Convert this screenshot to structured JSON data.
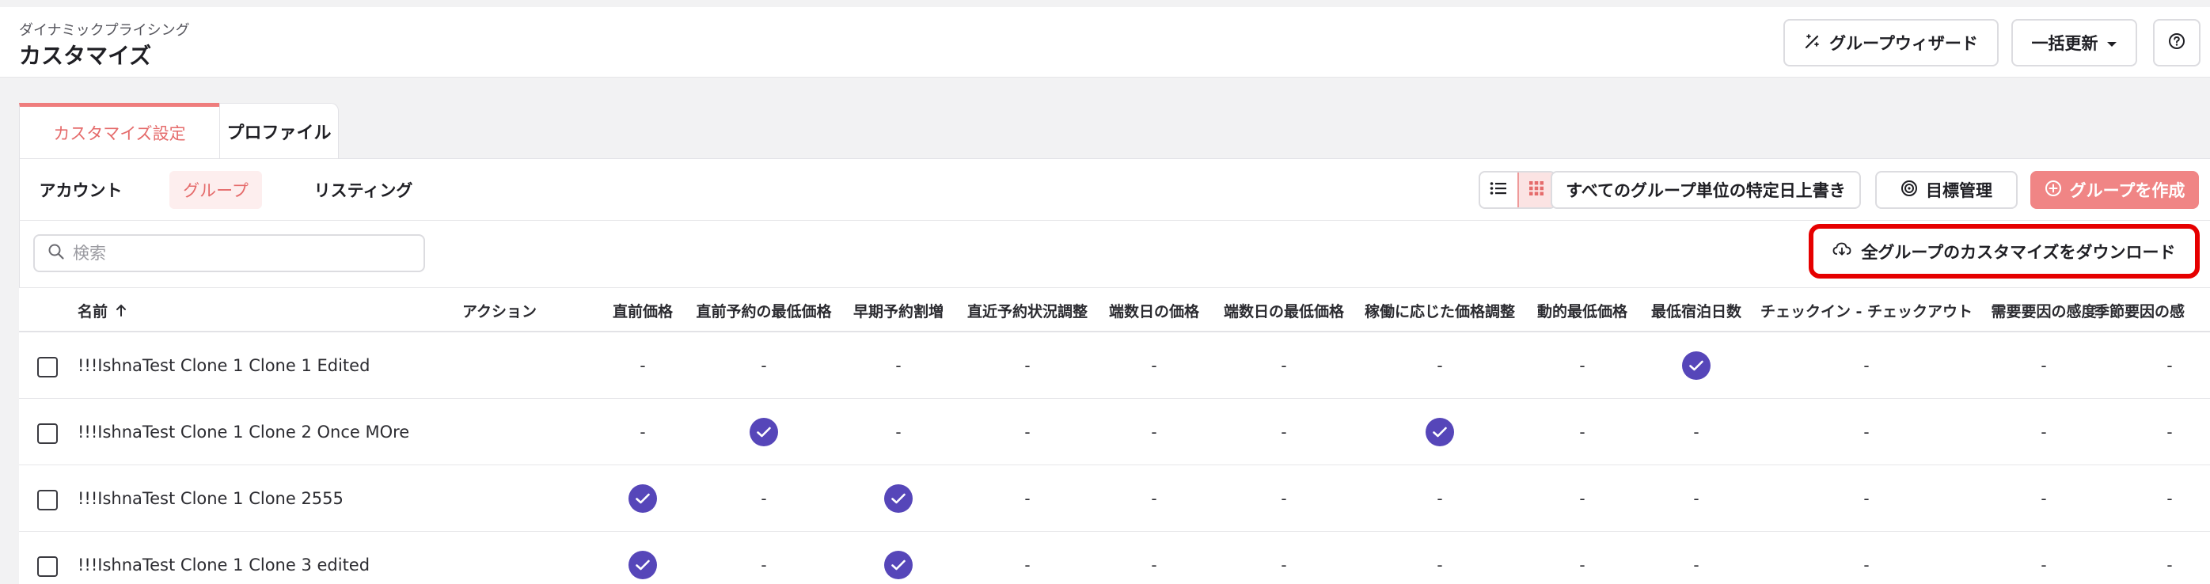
{
  "header": {
    "subtitle": "ダイナミックプライシング",
    "title": "カスタマイズ",
    "group_wizard_label": "グループウィザード",
    "bulk_update_label": "一括更新",
    "help_icon": "question-circle-icon"
  },
  "tabs": [
    {
      "label": "カスタマイズ設定",
      "active": true
    },
    {
      "label": "プロファイル",
      "active": false
    }
  ],
  "subnav": {
    "items": [
      {
        "label": "アカウント",
        "active": false
      },
      {
        "label": "グループ",
        "active": true
      },
      {
        "label": "リスティング",
        "active": false
      }
    ],
    "override_label": "すべてのグループ単位の特定日上書き",
    "goal_label": "目標管理",
    "create_group_label": "グループを作成"
  },
  "toolbar": {
    "search_placeholder": "検索",
    "download_label": "全グループのカスタマイズをダウンロード"
  },
  "table": {
    "headers": {
      "name": "名前",
      "action": "アクション",
      "columns": [
        "直前価格",
        "直前予約の最低価格",
        "早期予約割増",
        "直近予約状況調整",
        "端数日の価格",
        "端数日の最低価格",
        "稼働に応じた価格調整",
        "動的最低価格",
        "最低宿泊日数",
        "チェックイン - チェックアウト",
        "需要要因の感度",
        "季節要因の感"
      ]
    },
    "rows": [
      {
        "name": "!!!IshnaTest Clone 1 Clone 1 Edited",
        "cells": [
          "-",
          "-",
          "-",
          "-",
          "-",
          "-",
          "-",
          "-",
          "✓",
          "-",
          "-",
          "-"
        ]
      },
      {
        "name": "!!!IshnaTest Clone 1 Clone 2 Once MOre",
        "cells": [
          "-",
          "✓",
          "-",
          "-",
          "-",
          "-",
          "✓",
          "-",
          "-",
          "-",
          "-",
          "-"
        ]
      },
      {
        "name": "!!!IshnaTest Clone 1 Clone 2555",
        "cells": [
          "✓",
          "-",
          "✓",
          "-",
          "-",
          "-",
          "-",
          "-",
          "-",
          "-",
          "-",
          "-"
        ]
      },
      {
        "name": "!!!IshnaTest Clone 1 Clone 3 edited",
        "cells": [
          "✓",
          "-",
          "✓",
          "-",
          "-",
          "-",
          "-",
          "-",
          "-",
          "-",
          "-",
          "-"
        ]
      }
    ]
  },
  "colors": {
    "accent": "#f08585",
    "check": "#5646b9",
    "highlight": "#e60000"
  }
}
